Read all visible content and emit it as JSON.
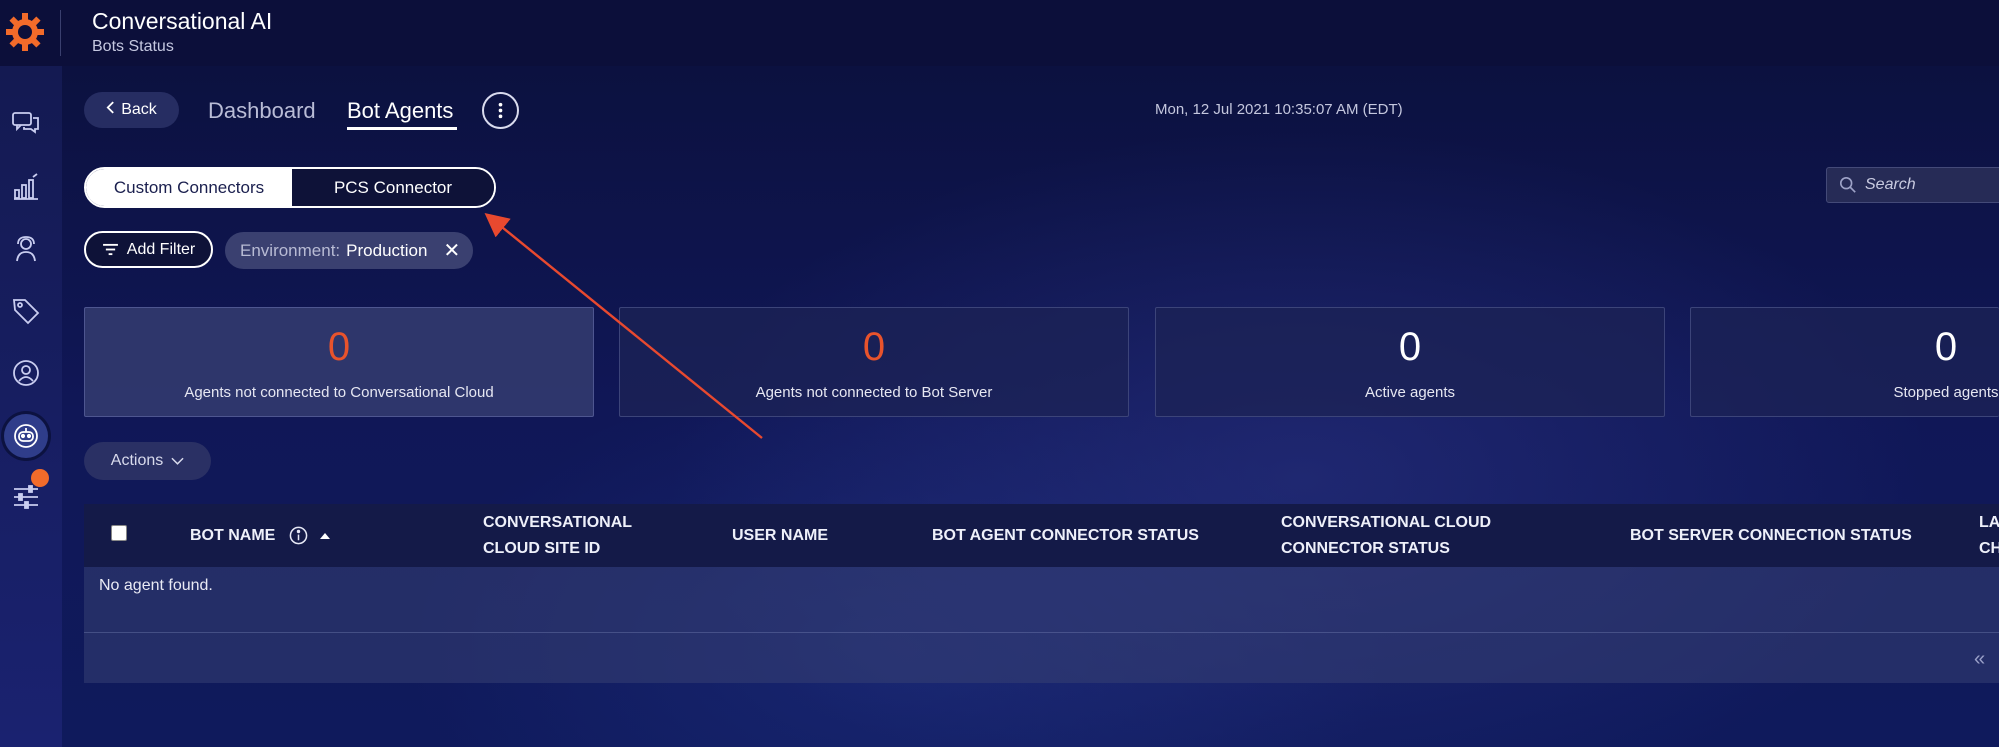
{
  "colors": {
    "accent_orange": "#f26b2a",
    "red_number": "#e8532c",
    "annotation_arrow": "#e8492f"
  },
  "header": {
    "title": "Conversational AI",
    "subtitle": "Bots Status",
    "logo_icon": "gear-logo-icon"
  },
  "sidebar": {
    "items": [
      {
        "icon": "chat-bubbles-icon"
      },
      {
        "icon": "bar-chart-icon"
      },
      {
        "icon": "agent-icon"
      },
      {
        "icon": "tag-icon"
      },
      {
        "icon": "user-circle-icon"
      },
      {
        "icon": "bot-icon",
        "active": true
      },
      {
        "icon": "sliders-icon",
        "notification": true
      }
    ]
  },
  "nav": {
    "back_label": "Back",
    "tabs": [
      {
        "label": "Dashboard",
        "active": false
      },
      {
        "label": "Bot Agents",
        "active": true
      }
    ],
    "datetime": "Mon, 12 Jul 2021 10:35:07 AM (EDT)"
  },
  "connectors": {
    "options": [
      "Custom Connectors",
      "PCS Connector"
    ],
    "selected": "Custom Connectors"
  },
  "search": {
    "placeholder": "Search"
  },
  "filters": {
    "add_label": "Add Filter",
    "chips": [
      {
        "key": "Environment:",
        "value": "Production"
      }
    ]
  },
  "stats": [
    {
      "value": "0",
      "label": "Agents not connected to Conversational Cloud"
    },
    {
      "value": "0",
      "label": "Agents not connected to Bot Server"
    },
    {
      "value": "0",
      "label": "Active agents"
    },
    {
      "value": "0",
      "label": "Stopped agents"
    }
  ],
  "actions_label": "Actions",
  "table": {
    "columns": [
      {
        "line1": "BOT NAME",
        "line2": ""
      },
      {
        "line1": "CONVERSATIONAL",
        "line2": "CLOUD SITE ID"
      },
      {
        "line1": "USER NAME",
        "line2": ""
      },
      {
        "line1": "BOT AGENT CONNECTOR STATUS",
        "line2": ""
      },
      {
        "line1": "CONVERSATIONAL CLOUD",
        "line2": "CONNECTOR STATUS"
      },
      {
        "line1": "BOT SERVER CONNECTION STATUS",
        "line2": ""
      },
      {
        "line1": "LA",
        "line2": "CH"
      }
    ],
    "empty_message": "No agent found.",
    "pager_symbol": "«"
  }
}
